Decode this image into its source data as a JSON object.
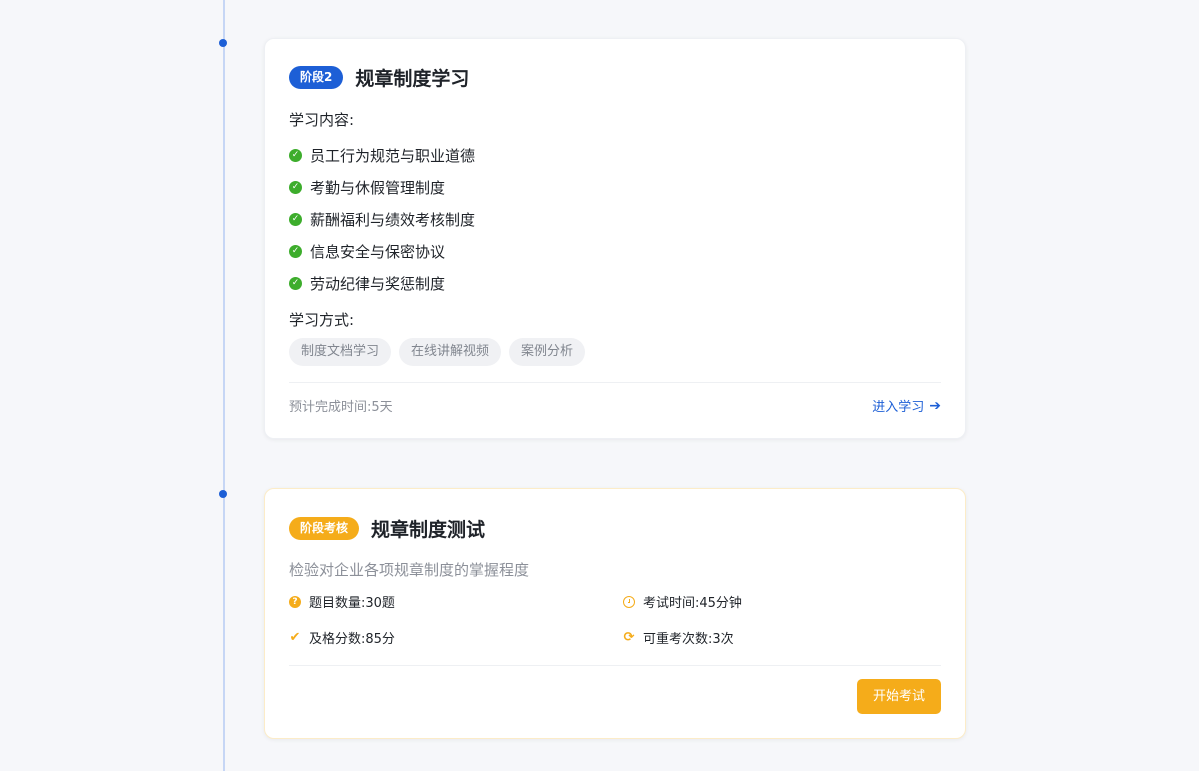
{
  "stage_card": {
    "badge": "阶段2",
    "title": "规章制度学习",
    "content_label": "学习内容:",
    "items": [
      "员工行为规范与职业道德",
      "考勤与休假管理制度",
      "薪酬福利与绩效考核制度",
      "信息安全与保密协议",
      "劳动纪律与奖惩制度"
    ],
    "method_label": "学习方式:",
    "methods": [
      "制度文档学习",
      "在线讲解视频",
      "案例分析"
    ],
    "estimate": "预计完成时间:5天",
    "enter_label": "进入学习",
    "check_icon": "check-circle-icon",
    "arrow_icon": "arrow-right-icon"
  },
  "exam_card": {
    "badge": "阶段考核",
    "title": "规章制度测试",
    "description": "检验对企业各项规章制度的掌握程度",
    "question_count": "题目数量:30题",
    "exam_time": "考试时间:45分钟",
    "pass_score": "及格分数:85分",
    "retakes": "可重考次数:3次",
    "start_label": "开始考试",
    "icons": [
      "question-circle-icon",
      "clock-icon",
      "check-icon",
      "refresh-icon"
    ]
  },
  "colors": {
    "accent_blue": "#1d5fd6",
    "accent_orange": "#f5ac1a",
    "success_green": "#3dad2c",
    "timeline_line": "#c6d6f5",
    "background": "#f6f7fa"
  }
}
